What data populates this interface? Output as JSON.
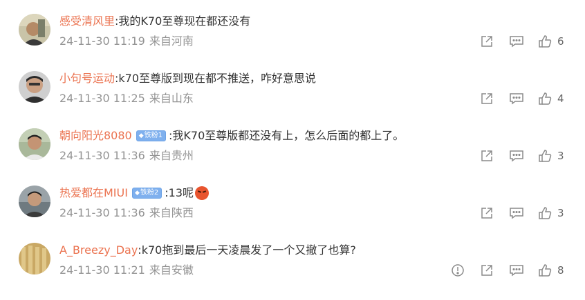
{
  "comments": [
    {
      "username": "感受清风里",
      "text": ":我的K70至尊现在都还没有",
      "time": "24-11-30 11:19",
      "location": "来自河南",
      "likes": "6",
      "badge": "",
      "emoji_icon": ""
    },
    {
      "username": "小句号运动",
      "text": ":k70至尊版到现在都不推送，咋好意思说",
      "time": "24-11-30 11:25",
      "location": "来自山东",
      "likes": "4",
      "badge": "",
      "emoji_icon": ""
    },
    {
      "username": "朝向阳光8080",
      "text": ":我K70至尊版都还没有上，怎么后面的都上了。",
      "time": "24-11-30 11:36",
      "location": "来自贵州",
      "likes": "3",
      "badge": "铁粉1",
      "emoji_icon": ""
    },
    {
      "username": "热爱都在MIUI",
      "text": ":13呢",
      "time": "24-11-30 11:36",
      "location": "来自陕西",
      "likes": "3",
      "badge": "铁粉2",
      "emoji_icon": "angry-face-emoji"
    },
    {
      "username": "A_Breezy_Day",
      "text": ":k70拖到最后一天凌晨发了一个又撤了也算?",
      "time": "24-11-30 11:21",
      "location": "来自安徽",
      "likes": "8",
      "badge": "",
      "emoji_icon": ""
    }
  ],
  "icons": {
    "share": "share-icon",
    "reply": "comment-icon",
    "like": "thumbs-up-icon",
    "report": "report-icon",
    "badge": "diamond-icon"
  },
  "colors": {
    "username": "#eb7350",
    "meta": "#939393",
    "text": "#333333",
    "badge": "#7fb0ee"
  }
}
